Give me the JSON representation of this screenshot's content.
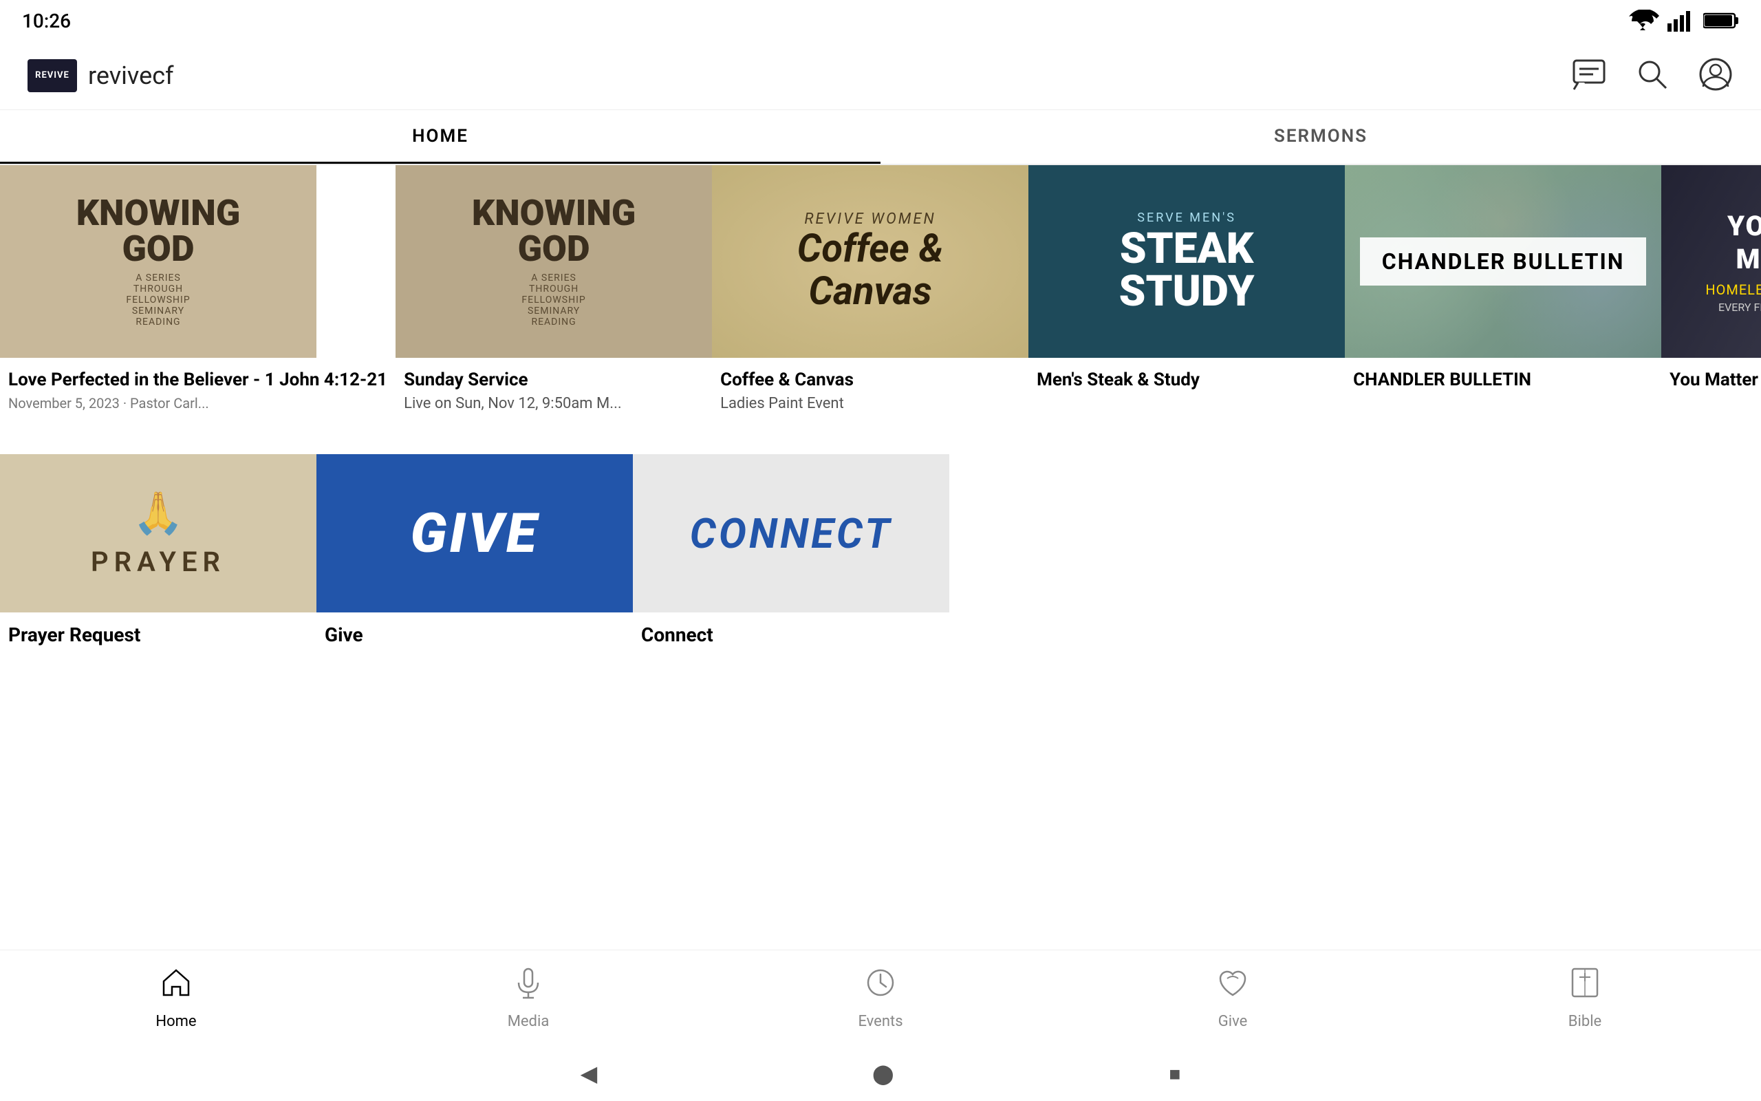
{
  "statusBar": {
    "time": "10:26"
  },
  "header": {
    "logoText": "REVIVE",
    "appName": "revivecf"
  },
  "navTabs": [
    {
      "id": "home",
      "label": "HOME",
      "active": true
    },
    {
      "id": "sermons",
      "label": "SERMONS",
      "active": false
    }
  ],
  "mediaCards": [
    {
      "id": "knowing-god-1",
      "thumbType": "knowing-god-1",
      "title": "Love Perfected in the Believer - 1 John 4:12-21",
      "subtitle": "",
      "meta": "November 5, 2023 · Pastor Carl..."
    },
    {
      "id": "knowing-god-2",
      "thumbType": "knowing-god-2",
      "title": "Sunday Service",
      "subtitle": "Live on Sun, Nov 12, 9:50am M...",
      "meta": ""
    },
    {
      "id": "coffee-canvas",
      "thumbType": "coffee",
      "title": "Coffee & Canvas",
      "subtitle": "Ladies Paint Event",
      "meta": ""
    },
    {
      "id": "steak-study",
      "thumbType": "steak",
      "title": "Men's Steak & Study",
      "subtitle": "",
      "meta": ""
    },
    {
      "id": "chandler-bulletin",
      "thumbType": "chandler",
      "title": "CHANDLER BULLETIN",
      "subtitle": "",
      "meta": ""
    },
    {
      "id": "you-matter",
      "thumbType": "youmatter",
      "title": "You Matter Ministries",
      "subtitle": "",
      "meta": ""
    }
  ],
  "actionCards": [
    {
      "id": "prayer",
      "thumbType": "prayer",
      "title": "Prayer Request"
    },
    {
      "id": "give",
      "thumbType": "give",
      "title": "Give"
    },
    {
      "id": "connect",
      "thumbType": "connect",
      "title": "Connect"
    }
  ],
  "bottomNav": [
    {
      "id": "home",
      "label": "Home",
      "icon": "home",
      "active": true
    },
    {
      "id": "media",
      "label": "Media",
      "icon": "mic",
      "active": false
    },
    {
      "id": "events",
      "label": "Events",
      "icon": "clock",
      "active": false
    },
    {
      "id": "give",
      "label": "Give",
      "icon": "heart",
      "active": false
    },
    {
      "id": "bible",
      "label": "Bible",
      "icon": "book",
      "active": false
    }
  ],
  "thumbLabels": {
    "knowingGod": "KNOWING\nGOD",
    "knowingGodSub": "A SERIES\nTHROUGH\nFELLOWSHIP\nSEMINARY\nREADING",
    "coffeeLabel": "REVIVE WOMEN",
    "coffeeTitle": "Coffee & Canvas",
    "steakLabel": "SERVE MEN'S",
    "steakTitle": "STEAK\nSTUDY",
    "chandlerText": "CHANDLER  BULLETIN",
    "youMatterTitle": "YOU MATTER\nMINISTRIES",
    "youMatterSub": "HOMELESS OUTREACH MINISTRY",
    "youMatterNote": "EVERY FIRST SATURDAY OF THE MONTH",
    "prayerText": "PRAYER",
    "giveText": "GIVE",
    "connectText": "CONNECT"
  }
}
